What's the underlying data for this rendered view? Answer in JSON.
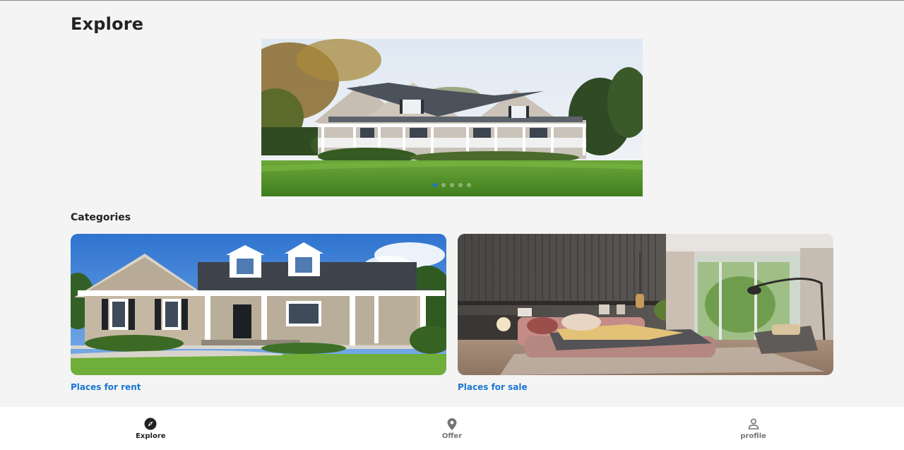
{
  "header": {
    "title": "Explore"
  },
  "carousel": {
    "slide_count": 5,
    "active_index": 0
  },
  "categories": {
    "title": "Categories",
    "items": [
      {
        "label": "Places for rent"
      },
      {
        "label": "Places for sale"
      }
    ]
  },
  "bottom_nav": {
    "items": [
      {
        "label": "Explore",
        "icon": "compass-icon",
        "active": true
      },
      {
        "label": "Offer",
        "icon": "location-pin-icon",
        "active": false
      },
      {
        "label": "profile",
        "icon": "person-icon",
        "active": false
      }
    ]
  },
  "colors": {
    "accent": "#1976d2",
    "background": "#f4f4f4"
  }
}
